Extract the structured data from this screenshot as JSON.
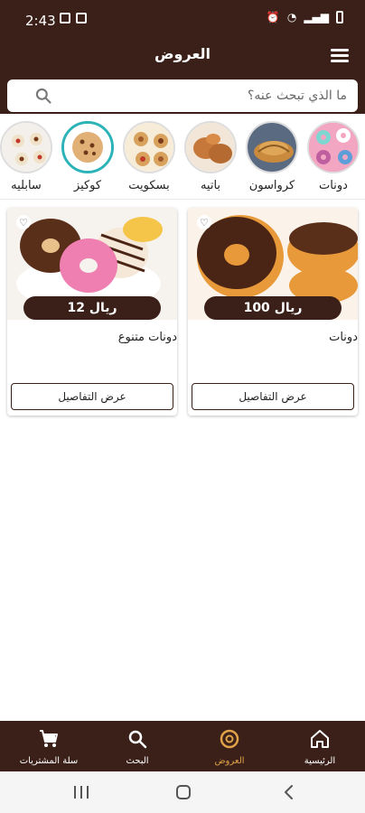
{
  "status": {
    "time": "2:43"
  },
  "header": {
    "title": "العروض"
  },
  "search": {
    "placeholder": "ما الذي تبحث عنه؟"
  },
  "categories": [
    {
      "label": "دونات"
    },
    {
      "label": "كرواسون"
    },
    {
      "label": "باتيه"
    },
    {
      "label": "بسكويت"
    },
    {
      "label": "كوكيز"
    },
    {
      "label": "سابليه"
    }
  ],
  "products": [
    {
      "price": "100 ريال",
      "name": "دونات",
      "details_label": "عرض التفاصيل"
    },
    {
      "price": "12 ريال",
      "name": "دونات متنوع",
      "details_label": "عرض التفاصيل"
    }
  ],
  "bottom_nav": [
    {
      "label": "الرئيسية"
    },
    {
      "label": "العروض"
    },
    {
      "label": "البحث"
    },
    {
      "label": "سلة المشتريات"
    }
  ],
  "colors": {
    "brand": "#3a2018",
    "active": "#e1a34a"
  }
}
